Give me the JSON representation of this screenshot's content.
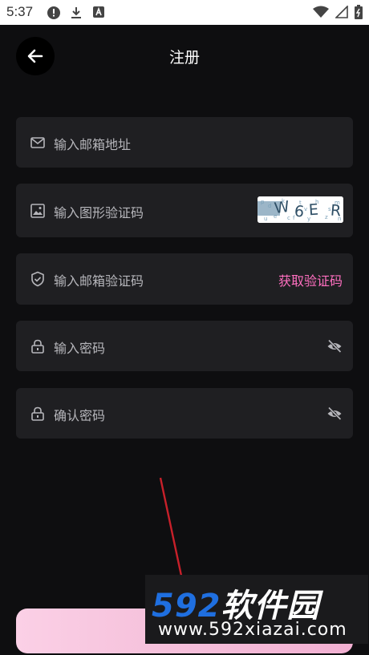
{
  "status_bar": {
    "time": "5:37"
  },
  "header": {
    "title": "注册"
  },
  "form": {
    "email_placeholder": "输入邮箱地址",
    "captcha_placeholder": "输入图形验证码",
    "captcha_text": "W6ER",
    "email_code_placeholder": "输入邮箱验证码",
    "get_code_label": "获取验证码",
    "password_placeholder": "输入密码",
    "confirm_password_placeholder": "确认密码"
  },
  "watermark": {
    "brand_number": "592",
    "brand_name": "软件园",
    "site": "www.592xiazai.com"
  },
  "colors": {
    "background": "#0e0e10",
    "field": "#1f1f22",
    "accent": "#ff6fc0"
  }
}
